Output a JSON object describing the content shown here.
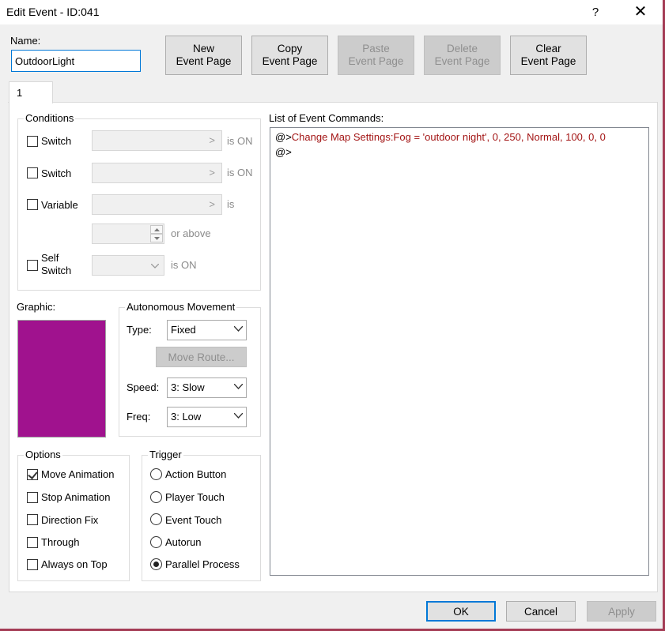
{
  "window": {
    "title": "Edit Event - ID:041",
    "help_glyph": "?",
    "close_glyph": "✕"
  },
  "name": {
    "label": "Name:",
    "value": "OutdoorLight"
  },
  "toolbar": {
    "new_line1": "New",
    "new_line2": "Event Page",
    "copy_line1": "Copy",
    "copy_line2": "Event Page",
    "paste_line1": "Paste",
    "paste_line2": "Event Page",
    "delete_line1": "Delete",
    "delete_line2": "Event Page",
    "clear_line1": "Clear",
    "clear_line2": "Event Page"
  },
  "tabs": [
    {
      "label": "1",
      "selected": true
    }
  ],
  "conditions": {
    "title": "Conditions",
    "switch1_label": "Switch",
    "switch1_suffix": "is ON",
    "switch2_label": "Switch",
    "switch2_suffix": "is ON",
    "variable_label": "Variable",
    "variable_suffix": "is",
    "or_above": "or above",
    "self_switch_line1": "Self",
    "self_switch_line2": "Switch",
    "self_switch_suffix": "is ON"
  },
  "graphic": {
    "label": "Graphic:",
    "color": "#a0128e"
  },
  "movement": {
    "title": "Autonomous Movement",
    "type_label": "Type:",
    "type_value": "Fixed",
    "move_route": "Move Route...",
    "speed_label": "Speed:",
    "speed_value": "3: Slow",
    "freq_label": "Freq:",
    "freq_value": "3: Low"
  },
  "options": {
    "title": "Options",
    "items": [
      {
        "label": "Move Animation",
        "checked": true
      },
      {
        "label": "Stop Animation",
        "checked": false
      },
      {
        "label": "Direction Fix",
        "checked": false
      },
      {
        "label": "Through",
        "checked": false
      },
      {
        "label": "Always on Top",
        "checked": false
      }
    ]
  },
  "trigger": {
    "title": "Trigger",
    "items": [
      {
        "label": "Action Button",
        "selected": false
      },
      {
        "label": "Player Touch",
        "selected": false
      },
      {
        "label": "Event Touch",
        "selected": false
      },
      {
        "label": "Autorun",
        "selected": false
      },
      {
        "label": "Parallel Process",
        "selected": true
      }
    ]
  },
  "commands": {
    "title": "List of Event Commands:",
    "lines": [
      {
        "prefix": "@>",
        "text": "Change Map Settings:Fog = 'outdoor night', 0, 250, Normal, 100, 0, 0"
      },
      {
        "prefix": "@>",
        "text": ""
      }
    ]
  },
  "footer": {
    "ok": "OK",
    "cancel": "Cancel",
    "apply": "Apply"
  },
  "colors": {
    "accent": "#0078d7",
    "command_text": "#a31515",
    "window_frame": "#a43c55"
  }
}
